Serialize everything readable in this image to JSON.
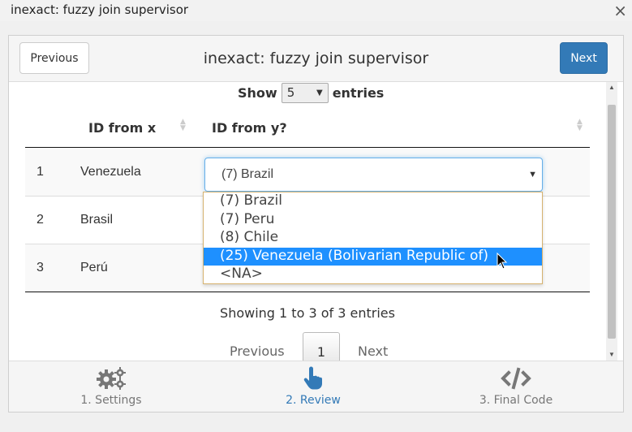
{
  "window": {
    "title": "inexact: fuzzy join supervisor",
    "close_label": "×"
  },
  "header": {
    "title": "inexact: fuzzy join supervisor",
    "previous_label": "Previous",
    "next_label": "Next"
  },
  "length_menu": {
    "show_label": "Show",
    "value": "5",
    "entries_label": "entries"
  },
  "table": {
    "columns": [
      "",
      "ID from x",
      "ID from y?"
    ],
    "rows": [
      {
        "n": "1",
        "x": "Venezuela",
        "y": "(7) Brazil"
      },
      {
        "n": "2",
        "x": "Brasil",
        "y": ""
      },
      {
        "n": "3",
        "x": "Perú",
        "y": ""
      }
    ]
  },
  "dropdown": {
    "options": [
      "(7) Brazil",
      "(7) Peru",
      "(8) Chile",
      "(25) Venezuela (Bolivarian Republic of)",
      "<NA>"
    ],
    "highlighted": "(25) Venezuela (Bolivarian Republic of)"
  },
  "info": "Showing 1 to 3 of 3 entries",
  "pagination": {
    "previous": "Previous",
    "page": "1",
    "next": "Next"
  },
  "tabs": [
    {
      "label": "1. Settings",
      "icon": "gears-icon",
      "active": false
    },
    {
      "label": "2. Review",
      "icon": "hand-pointer-icon",
      "active": true
    },
    {
      "label": "3. Final Code",
      "icon": "code-icon",
      "active": false
    }
  ],
  "colors": {
    "primary": "#337ab7",
    "highlight": "#1e90ff",
    "dropdown_border": "#d6b26f"
  }
}
